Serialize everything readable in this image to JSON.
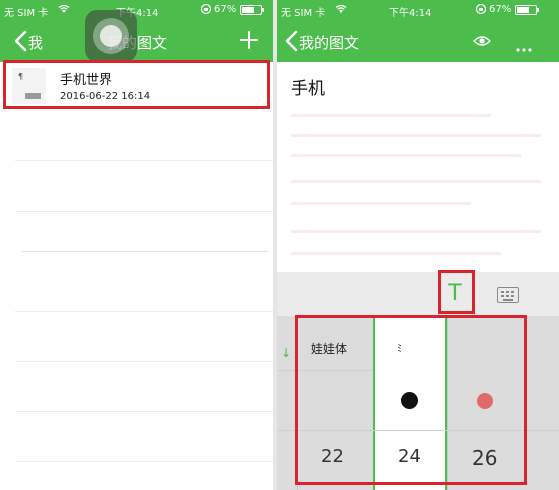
{
  "left": {
    "status": {
      "carrier": "无 SIM 卡",
      "wifi_icon": "wifi-icon",
      "time": "下午4:14",
      "battery": "67%",
      "battery_level": 0.67
    },
    "nav": {
      "back_label": "我",
      "title": "我的图文",
      "back_icon": "chevron-left-icon",
      "add_icon": "plus-icon"
    },
    "items": [
      {
        "title": "手机世界",
        "timestamp": "2016-06-22 16:14",
        "thumb_mark": "¶"
      }
    ]
  },
  "right": {
    "status": {
      "carrier": "无 SIM 卡",
      "wifi_icon": "wifi-icon",
      "time": "下午4:14",
      "battery": "67%",
      "battery_level": 0.67
    },
    "nav": {
      "title": "我的图文",
      "eye_icon": "eye-icon",
      "more_icon": "more-icon"
    },
    "editor": {
      "title": "手机"
    },
    "toolbar": {
      "text_tool_glyph": "T",
      "text_tool_icon": "text-format-icon",
      "keyboard_icon": "keyboard-icon"
    },
    "picker": {
      "arrow": "↓",
      "fonts": [
        "娃娃体",
        "ﾐ"
      ],
      "sizes": [
        "22",
        "24",
        "26"
      ],
      "colors": [
        "#111111",
        "#e06a6a"
      ]
    }
  },
  "colors": {
    "accent": "#4cbc4c",
    "highlight": "#d9232d"
  }
}
